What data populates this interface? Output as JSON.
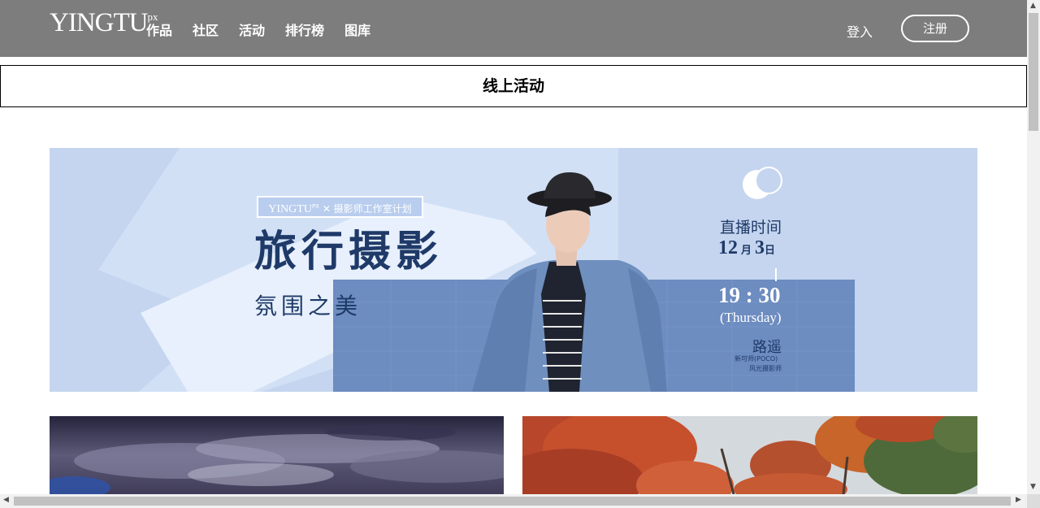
{
  "header": {
    "logo": "YINGTU",
    "logo_sup": "px",
    "nav": [
      "作品",
      "社区",
      "活动",
      "排行榜",
      "图库"
    ],
    "login": "登入",
    "register": "注册"
  },
  "section": {
    "title": "线上活动"
  },
  "banner": {
    "brand": "YINGTU",
    "brand_sup": "PX",
    "brand_tag": "✕ 摄影师工作室计划",
    "title": "旅行摄影",
    "subtitle": "氛围之美",
    "live_label": "直播时间",
    "month_num": "12",
    "month_unit": "月",
    "day_num": "3",
    "day_unit": "日",
    "time": "19 : 30",
    "weekday": "(Thursday)",
    "host": "路遥",
    "host_note1": "新可师(POCO)",
    "host_note2": "风光摄影师",
    "colors": {
      "bg": "#c5d5ef",
      "panel": "#6d8cc0",
      "text": "#1f3a68"
    }
  },
  "scrollbars": {
    "up_arrow": "▲",
    "down_arrow": "▼",
    "left_arrow": "◀",
    "right_arrow": "▶"
  }
}
